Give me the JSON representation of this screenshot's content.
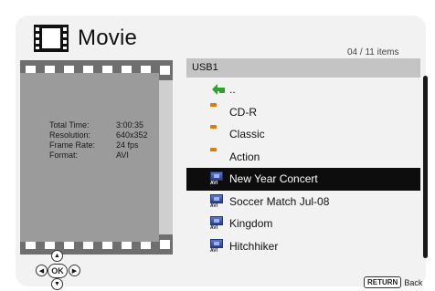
{
  "title": "Movie",
  "count": "04 / 11 items",
  "info": {
    "rows": [
      {
        "label": "Total Time:",
        "value": "3:00:35"
      },
      {
        "label": "Resolution:",
        "value": "640x352"
      },
      {
        "label": "Frame Rate:",
        "value": "24 fps"
      },
      {
        "label": "Format:",
        "value": "AVI"
      }
    ]
  },
  "list": {
    "header": "USB1",
    "items": [
      {
        "label": "..",
        "icon": "up-arrow-icon"
      },
      {
        "label": "CD-R",
        "icon": "folder-icon"
      },
      {
        "label": "Classic",
        "icon": "folder-icon"
      },
      {
        "label": "Action",
        "icon": "folder-icon"
      },
      {
        "label": "New Year Concert",
        "icon": "avi-file-icon",
        "tag": "AVI",
        "selected": true
      },
      {
        "label": "Soccer Match Jul-08",
        "icon": "avi-file-icon",
        "tag": "AVI"
      },
      {
        "label": "Kingdom",
        "icon": "avi-file-icon",
        "tag": "AVI"
      },
      {
        "label": "Hitchhiker",
        "icon": "avi-file-icon",
        "tag": "AVI"
      }
    ]
  },
  "remote": {
    "ok_label": "OK",
    "up": "▲",
    "down": "▼",
    "left": "◀",
    "right": "▶"
  },
  "return": {
    "key_label": "RETURN",
    "action_label": "Back"
  },
  "colors": {
    "selected_bg": "#0d0d0d",
    "folder": "#ee9a2c",
    "header_bg": "#c4c4c4",
    "up_arrow": "#2fa12f"
  }
}
